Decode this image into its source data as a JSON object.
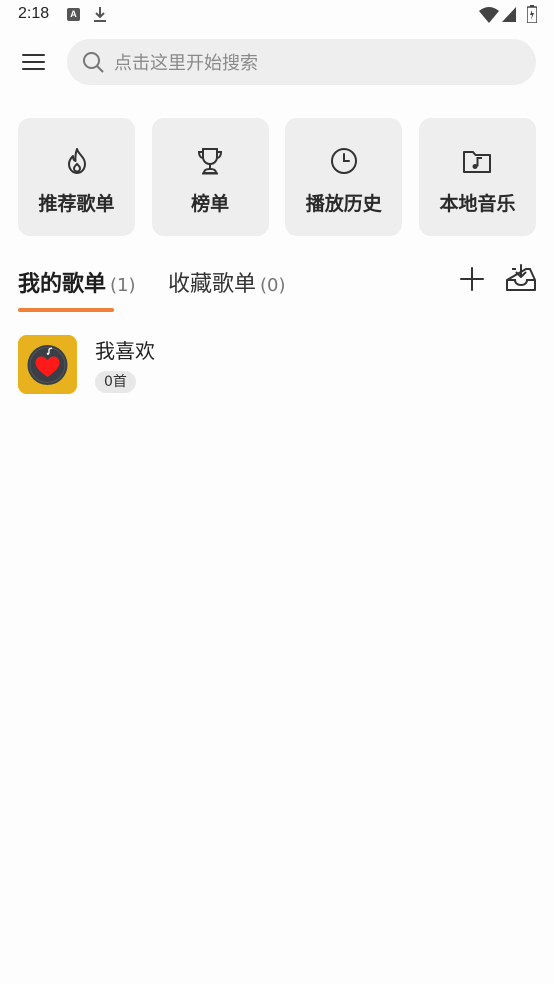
{
  "status_bar": {
    "time": "2:18",
    "icons": [
      "a-notification-icon",
      "download-icon",
      "wifi-icon",
      "signal-icon",
      "battery-icon"
    ]
  },
  "header": {
    "menu_icon": "hamburger-menu-icon",
    "search_placeholder": "点击这里开始搜索",
    "search_icon": "search-icon"
  },
  "shortcuts": [
    {
      "label": "推荐歌单",
      "icon": "fire-icon"
    },
    {
      "label": "榜单",
      "icon": "trophy-icon"
    },
    {
      "label": "播放历史",
      "icon": "clock-icon"
    },
    {
      "label": "本地音乐",
      "icon": "music-folder-icon"
    }
  ],
  "tabs": [
    {
      "label": "我的歌单",
      "count": "(1)",
      "active": true
    },
    {
      "label": "收藏歌单",
      "count": "(0)",
      "active": false
    }
  ],
  "tab_actions": {
    "add_icon": "plus-icon",
    "import_icon": "inbox-download-icon"
  },
  "accent_color": "#f0803a",
  "playlists": [
    {
      "name": "我喜欢",
      "count": "0首",
      "cover_icon": "heart-record-icon",
      "cover_color": "#e8b21e"
    }
  ]
}
